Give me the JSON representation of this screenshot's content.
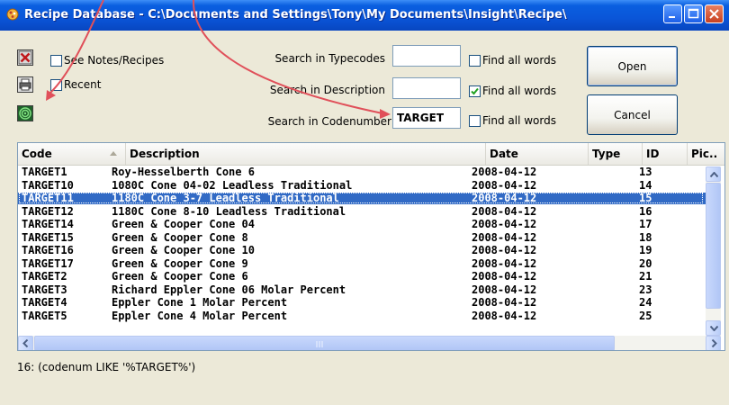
{
  "window": {
    "title": "Recipe Database - C:\\Documents and Settings\\Tony\\My Documents\\Insight\\Recipe\\"
  },
  "toolbar": {
    "see_notes_label": "See Notes/Recipes",
    "recent_label": "Recent",
    "see_notes_checked": false,
    "recent_checked": false
  },
  "search": {
    "typecodes_label": "Search in Typecodes",
    "description_label": "Search in Description",
    "codenumber_label": "Search in Codenumber",
    "typecodes_value": "",
    "description_value": "",
    "codenumber_value": "TARGET",
    "find_all_words_label": "Find all words",
    "typecodes_find_all": false,
    "description_find_all": true,
    "codenumber_find_all": false
  },
  "buttons": {
    "open_label": "Open",
    "cancel_label": "Cancel"
  },
  "table": {
    "columns": [
      "Code",
      "Description",
      "Date",
      "Type",
      "ID",
      "Pic.."
    ],
    "sorted_column": "Code",
    "selected_index": 2,
    "rows": [
      {
        "code": "TARGET1",
        "description": "Roy-Hesselberth Cone 6",
        "date": "2008-04-12",
        "type": "",
        "id": "13"
      },
      {
        "code": "TARGET10",
        "description": "1080C Cone 04-02 Leadless Traditional",
        "date": "2008-04-12",
        "type": "",
        "id": "14"
      },
      {
        "code": "TARGET11",
        "description": "1180C Cone 3-7 Leadless Traditional",
        "date": "2008-04-12",
        "type": "",
        "id": "15"
      },
      {
        "code": "TARGET12",
        "description": "1180C Cone 8-10 Leadless Traditional",
        "date": "2008-04-12",
        "type": "",
        "id": "16"
      },
      {
        "code": "TARGET14",
        "description": "Green & Cooper Cone 04",
        "date": "2008-04-12",
        "type": "",
        "id": "17"
      },
      {
        "code": "TARGET15",
        "description": "Green & Cooper Cone 8",
        "date": "2008-04-12",
        "type": "",
        "id": "18"
      },
      {
        "code": "TARGET16",
        "description": "Green & Cooper Cone 10",
        "date": "2008-04-12",
        "type": "",
        "id": "19"
      },
      {
        "code": "TARGET17",
        "description": "Green & Cooper Cone 9",
        "date": "2008-04-12",
        "type": "",
        "id": "20"
      },
      {
        "code": "TARGET2",
        "description": "Green & Cooper Cone 6",
        "date": "2008-04-12",
        "type": "",
        "id": "21"
      },
      {
        "code": "TARGET3",
        "description": "Richard Eppler Cone 06 Molar Percent",
        "date": "2008-04-12",
        "type": "",
        "id": "23"
      },
      {
        "code": "TARGET4",
        "description": "Eppler Cone 1 Molar Percent",
        "date": "2008-04-12",
        "type": "",
        "id": "24"
      },
      {
        "code": "TARGET5",
        "description": "Eppler Cone 4 Molar Percent",
        "date": "2008-04-12",
        "type": "",
        "id": "25"
      }
    ]
  },
  "status": {
    "text": "16: (codenum LIKE '%TARGET%')"
  },
  "colors": {
    "title_bar": "#0a55d8",
    "selection": "#316ac5",
    "annotation_arrow": "#e0505a",
    "window_bg": "#ece9d8"
  },
  "icons": [
    "recipe-app-icon",
    "close-box-icon",
    "printer-icon",
    "target-icon",
    "minimize-icon",
    "maximize-icon",
    "window-close-icon"
  ]
}
